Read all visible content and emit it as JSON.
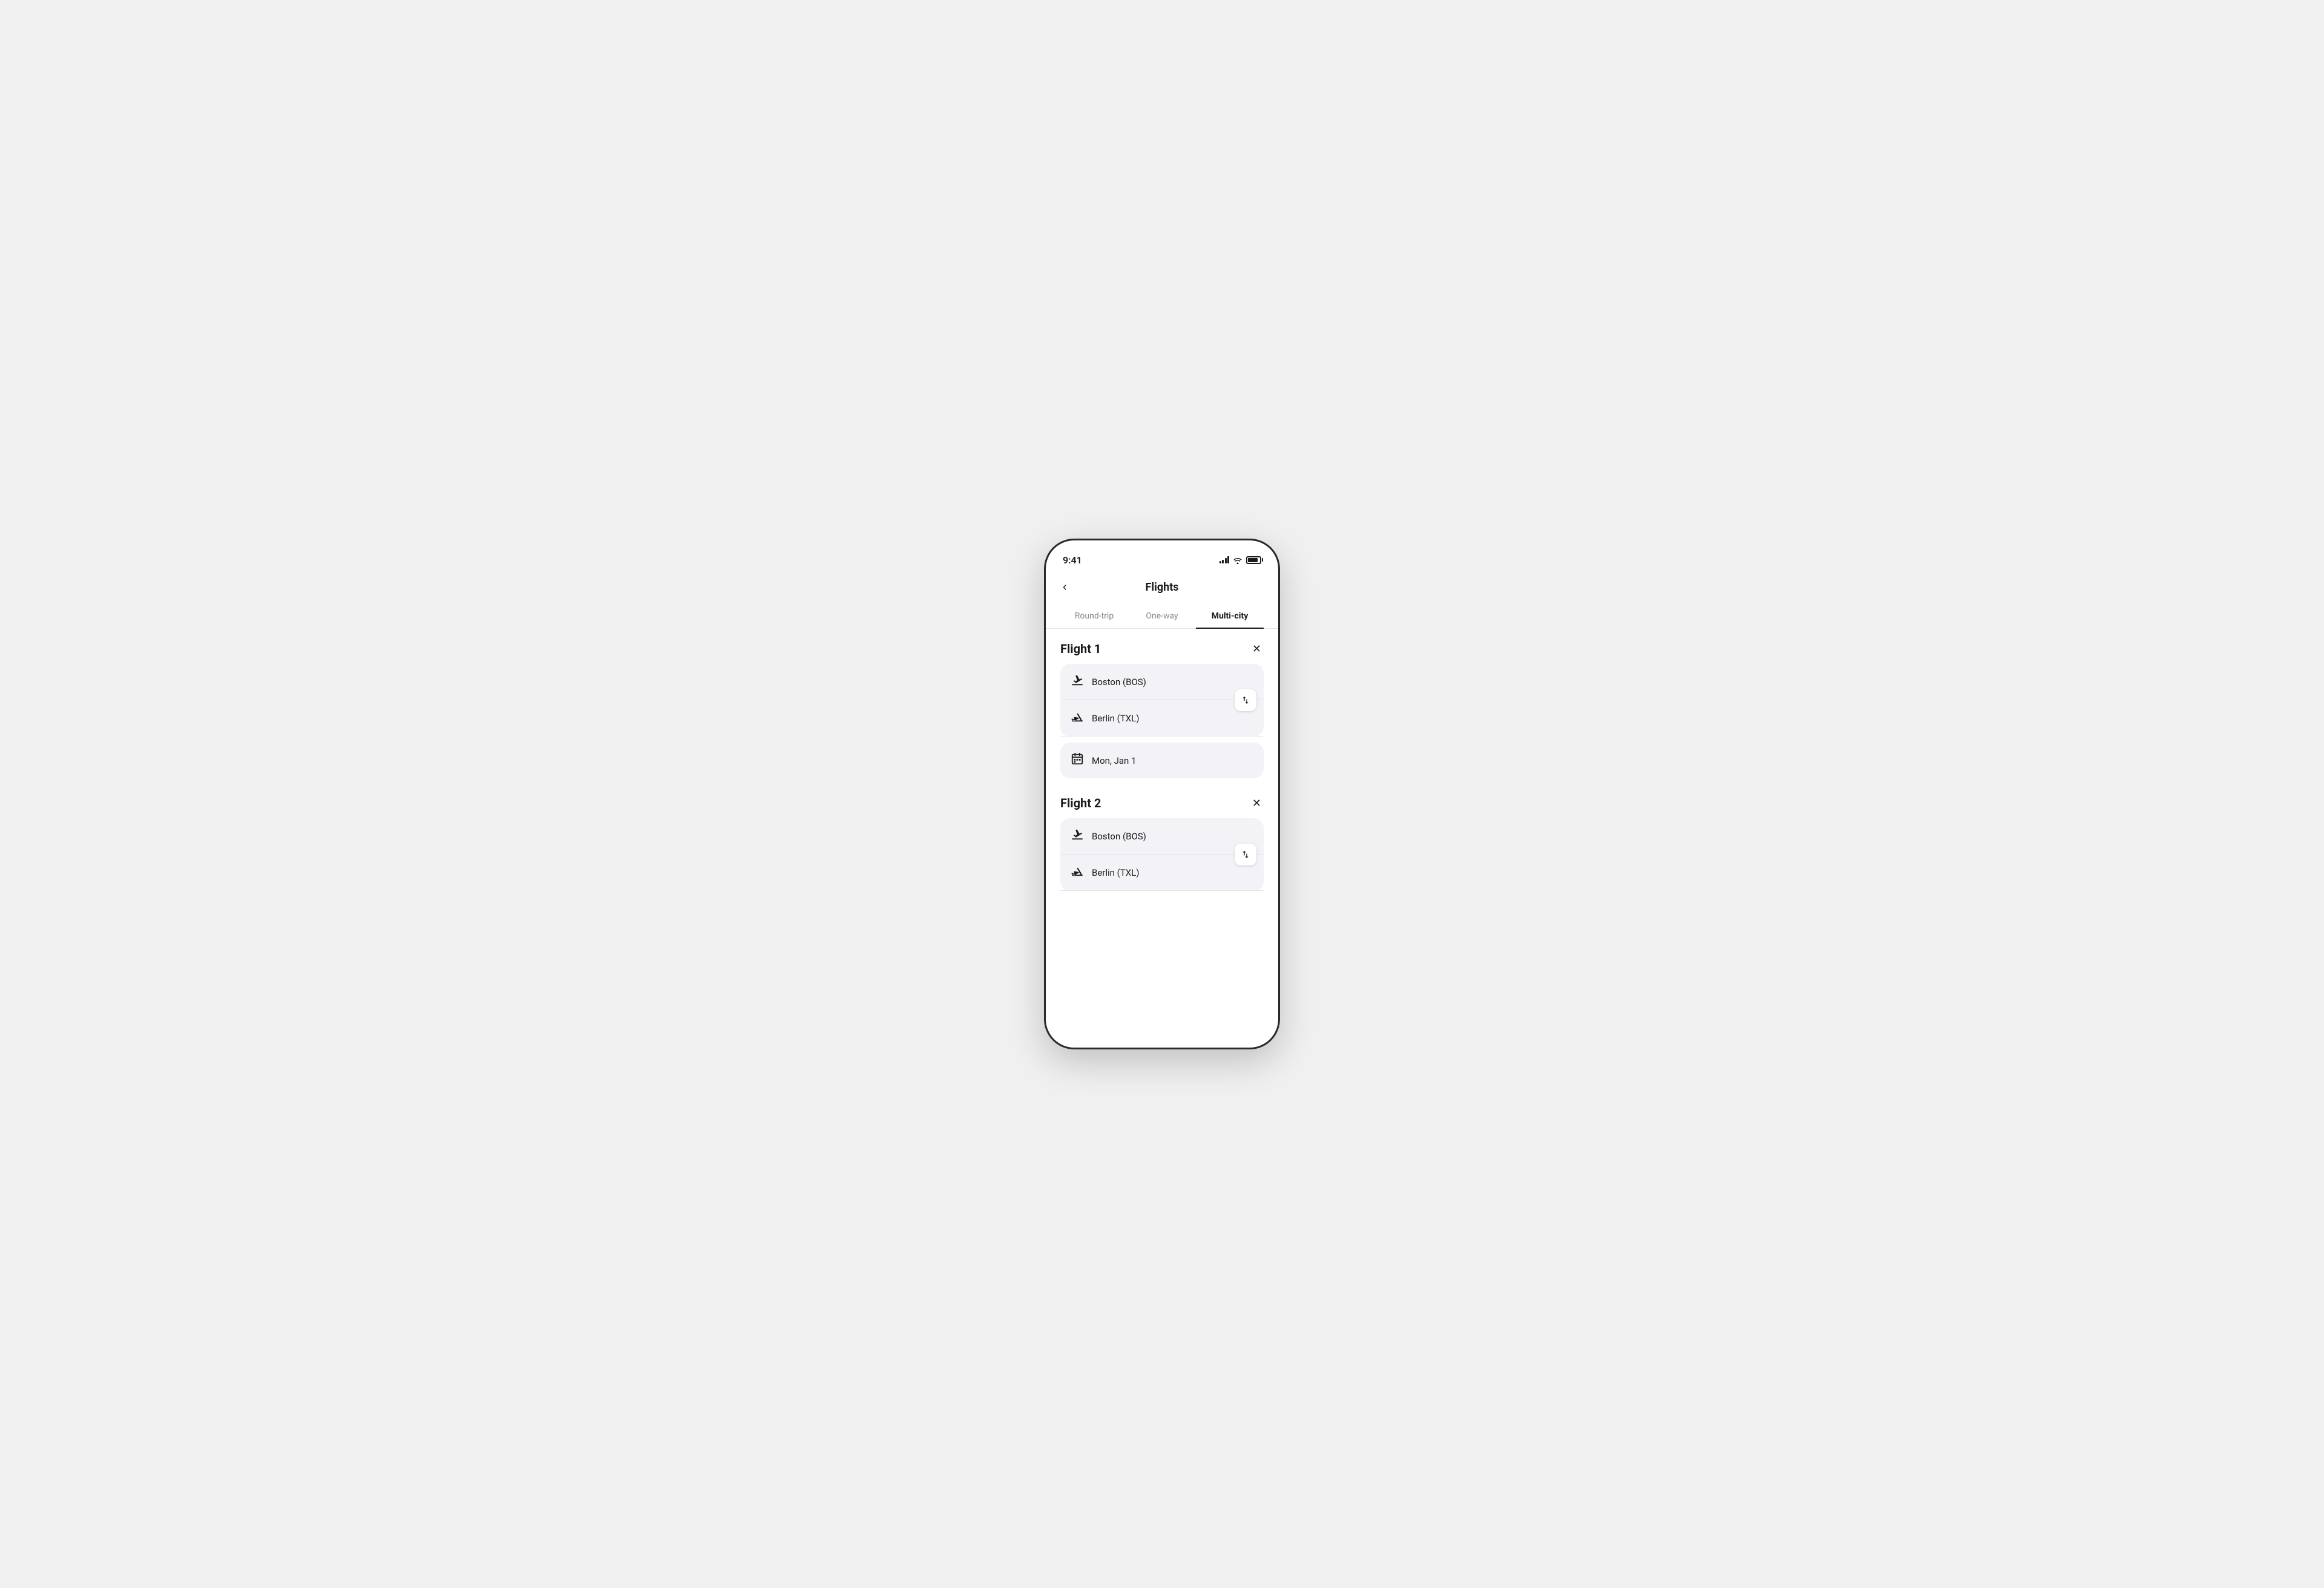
{
  "statusBar": {
    "time": "9:41",
    "signal": "signal-icon",
    "wifi": "wifi-icon",
    "battery": "battery-icon"
  },
  "header": {
    "backLabel": "<",
    "title": "Flights"
  },
  "tabs": [
    {
      "id": "round-trip",
      "label": "Round-trip",
      "active": false
    },
    {
      "id": "one-way",
      "label": "One-way",
      "active": false
    },
    {
      "id": "multi-city",
      "label": "Multi-city",
      "active": true
    }
  ],
  "flights": [
    {
      "id": "flight-1",
      "title": "Flight 1",
      "from": "Boston (BOS)",
      "to": "Berlin (TXL)",
      "date": "Mon, Jan 1"
    },
    {
      "id": "flight-2",
      "title": "Flight 2",
      "from": "Boston (BOS)",
      "to": "Berlin (TXL)",
      "date": null
    }
  ],
  "icons": {
    "close": "✕",
    "swap": "⇅",
    "back": "‹"
  }
}
